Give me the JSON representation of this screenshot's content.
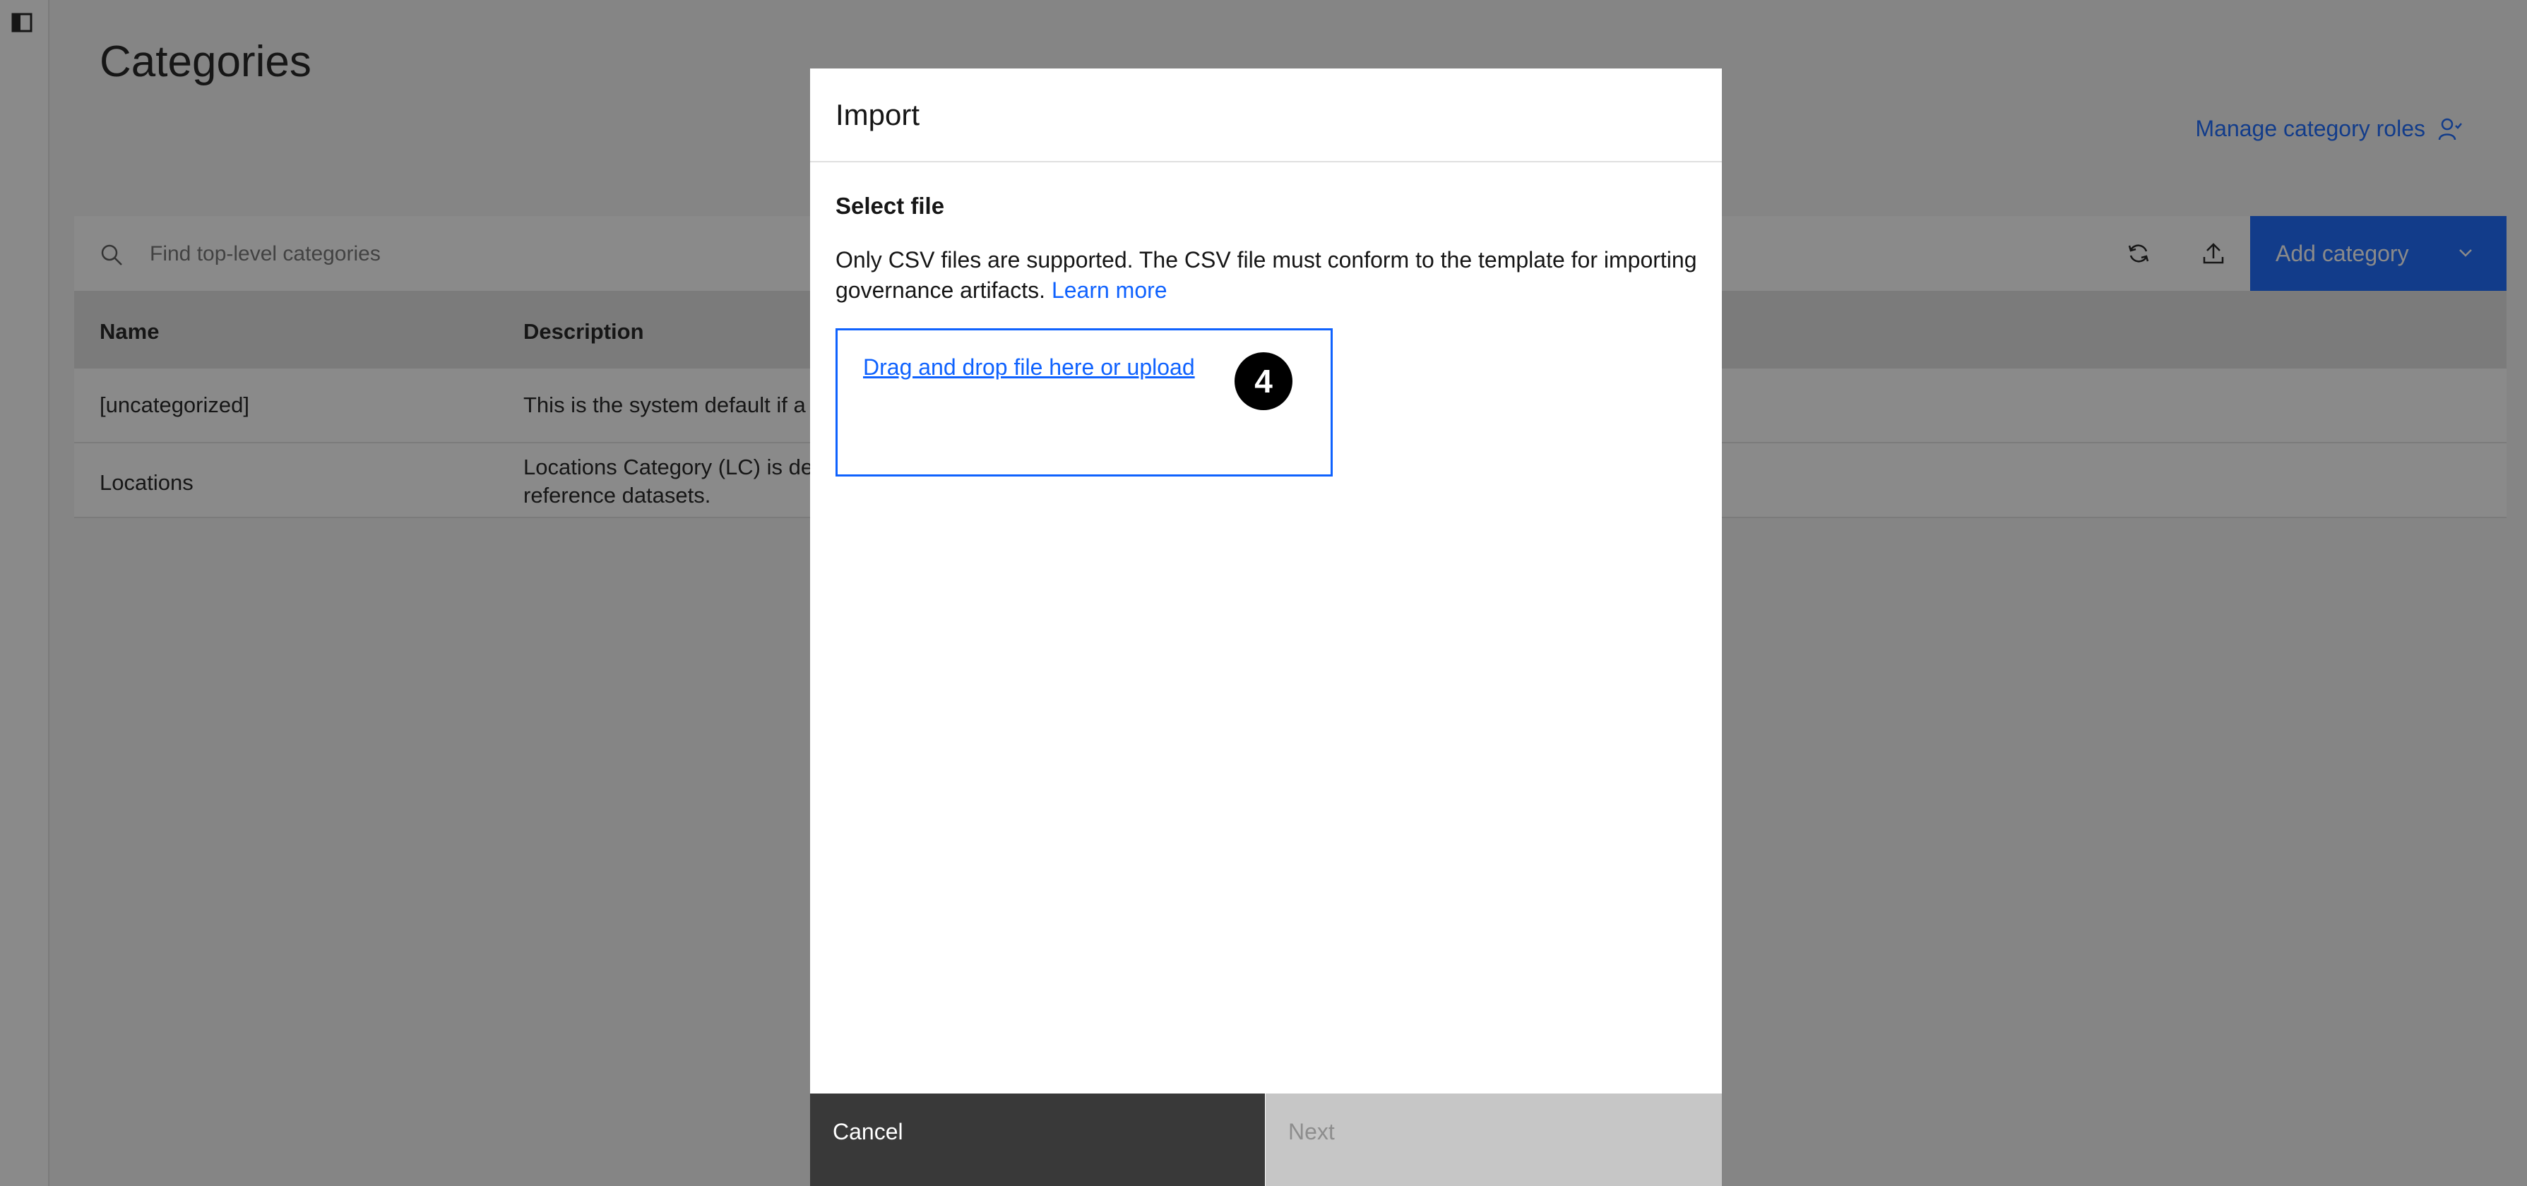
{
  "page": {
    "title": "Categories",
    "manage_roles_label": "Manage category roles"
  },
  "toolbar": {
    "search_placeholder": "Find top-level categories",
    "add_category_label": "Add category",
    "icons": [
      "refresh-icon",
      "upload-icon",
      "grid-view-icon",
      "chevron-down-icon"
    ]
  },
  "table": {
    "columns": [
      "Name",
      "Description"
    ],
    "rows": [
      {
        "name": "[uncategorized]",
        "description": "This is the system default if a"
      },
      {
        "name": "Locations",
        "description_line1": "Locations Category (LC) is de",
        "description_line2": "reference datasets."
      }
    ]
  },
  "modal": {
    "title": "Import",
    "section_title": "Select file",
    "description": "Only CSV files are supported. The CSV file must conform to the template for importing governance artifacts.",
    "learn_more": "Learn more",
    "dropzone_label": "Drag and drop file here or upload",
    "cancel_label": "Cancel",
    "next_label": "Next"
  },
  "step_badge": "4",
  "colors": {
    "accent": "#0f62fe",
    "overlay": "rgba(22,22,22,0.5)",
    "cancel_bg": "#393939",
    "disabled_bg": "#c6c6c6"
  }
}
